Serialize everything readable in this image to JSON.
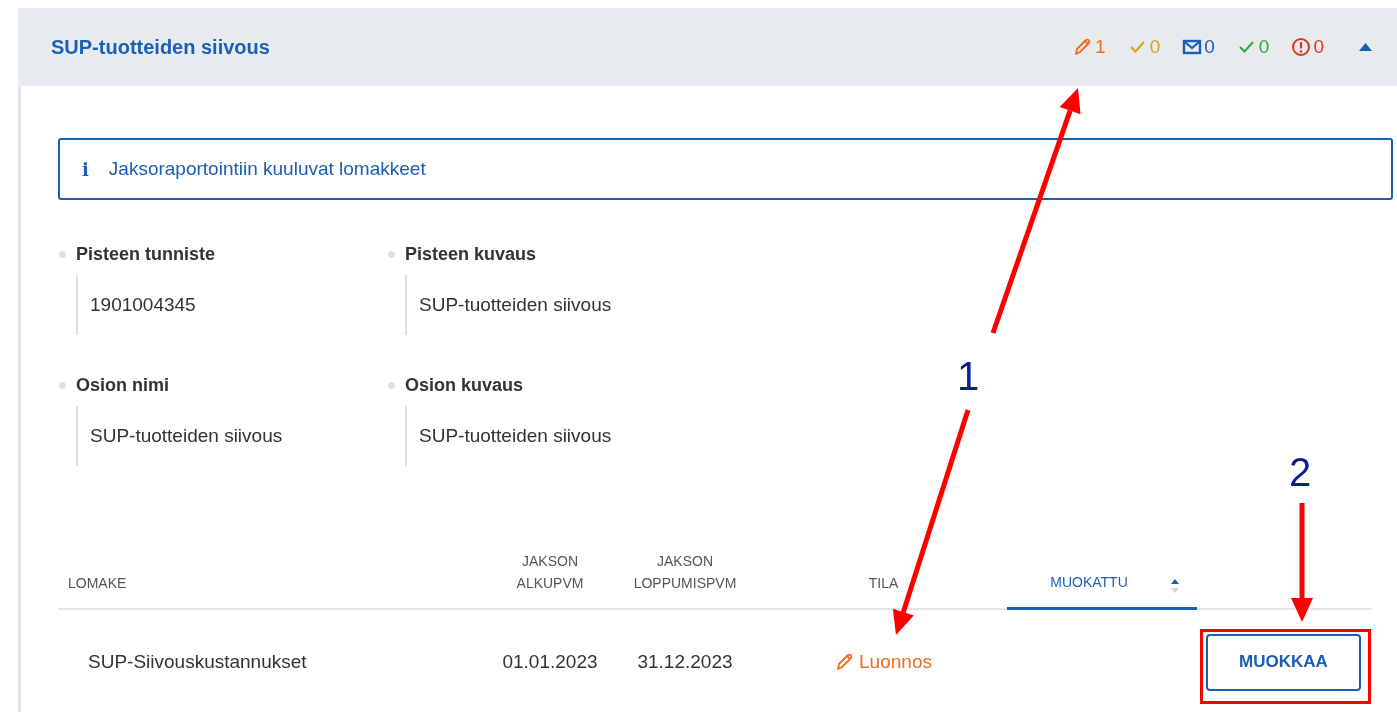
{
  "panel": {
    "title": "SUP-tuotteiden siivous",
    "expanded": true,
    "counters": [
      {
        "kind": "pencil",
        "count": "1",
        "color": "#f26b21"
      },
      {
        "kind": "check",
        "count": "0",
        "color": "#d4a017"
      },
      {
        "kind": "mail",
        "count": "0",
        "color": "#1a5fb4"
      },
      {
        "kind": "check",
        "count": "0",
        "color": "#2eaa3f"
      },
      {
        "kind": "alert",
        "count": "0",
        "color": "#d9381e"
      }
    ],
    "info": {
      "icon": "i",
      "text": "Jaksoraportointiin kuuluvat lomakkeet"
    },
    "fields": [
      {
        "label": "Pisteen tunniste",
        "value": "1901004345"
      },
      {
        "label": "Pisteen kuvaus",
        "value": "SUP-tuotteiden siivous"
      },
      {
        "label": "Osion nimi",
        "value": "SUP-tuotteiden siivous"
      },
      {
        "label": "Osion kuvaus",
        "value": "SUP-tuotteiden siivous"
      }
    ],
    "table": {
      "columns": [
        {
          "label": "LOMAKE",
          "sorted": false
        },
        {
          "label": "JAKSON ALKUPVM",
          "sorted": false
        },
        {
          "label": "JAKSON LOPPUMISPVM",
          "sorted": false
        },
        {
          "label": "TILA",
          "sorted": false
        },
        {
          "label": "MUOKATTU",
          "sorted": true
        }
      ],
      "rows": [
        {
          "form": "SUP-Siivouskustannukset",
          "start": "01.01.2023",
          "end": "31.12.2023",
          "status": {
            "kind": "draft",
            "label": "Luonnos"
          },
          "action": "MUOKKAA"
        }
      ]
    }
  },
  "annotations": {
    "numbers": [
      "1",
      "2"
    ]
  }
}
